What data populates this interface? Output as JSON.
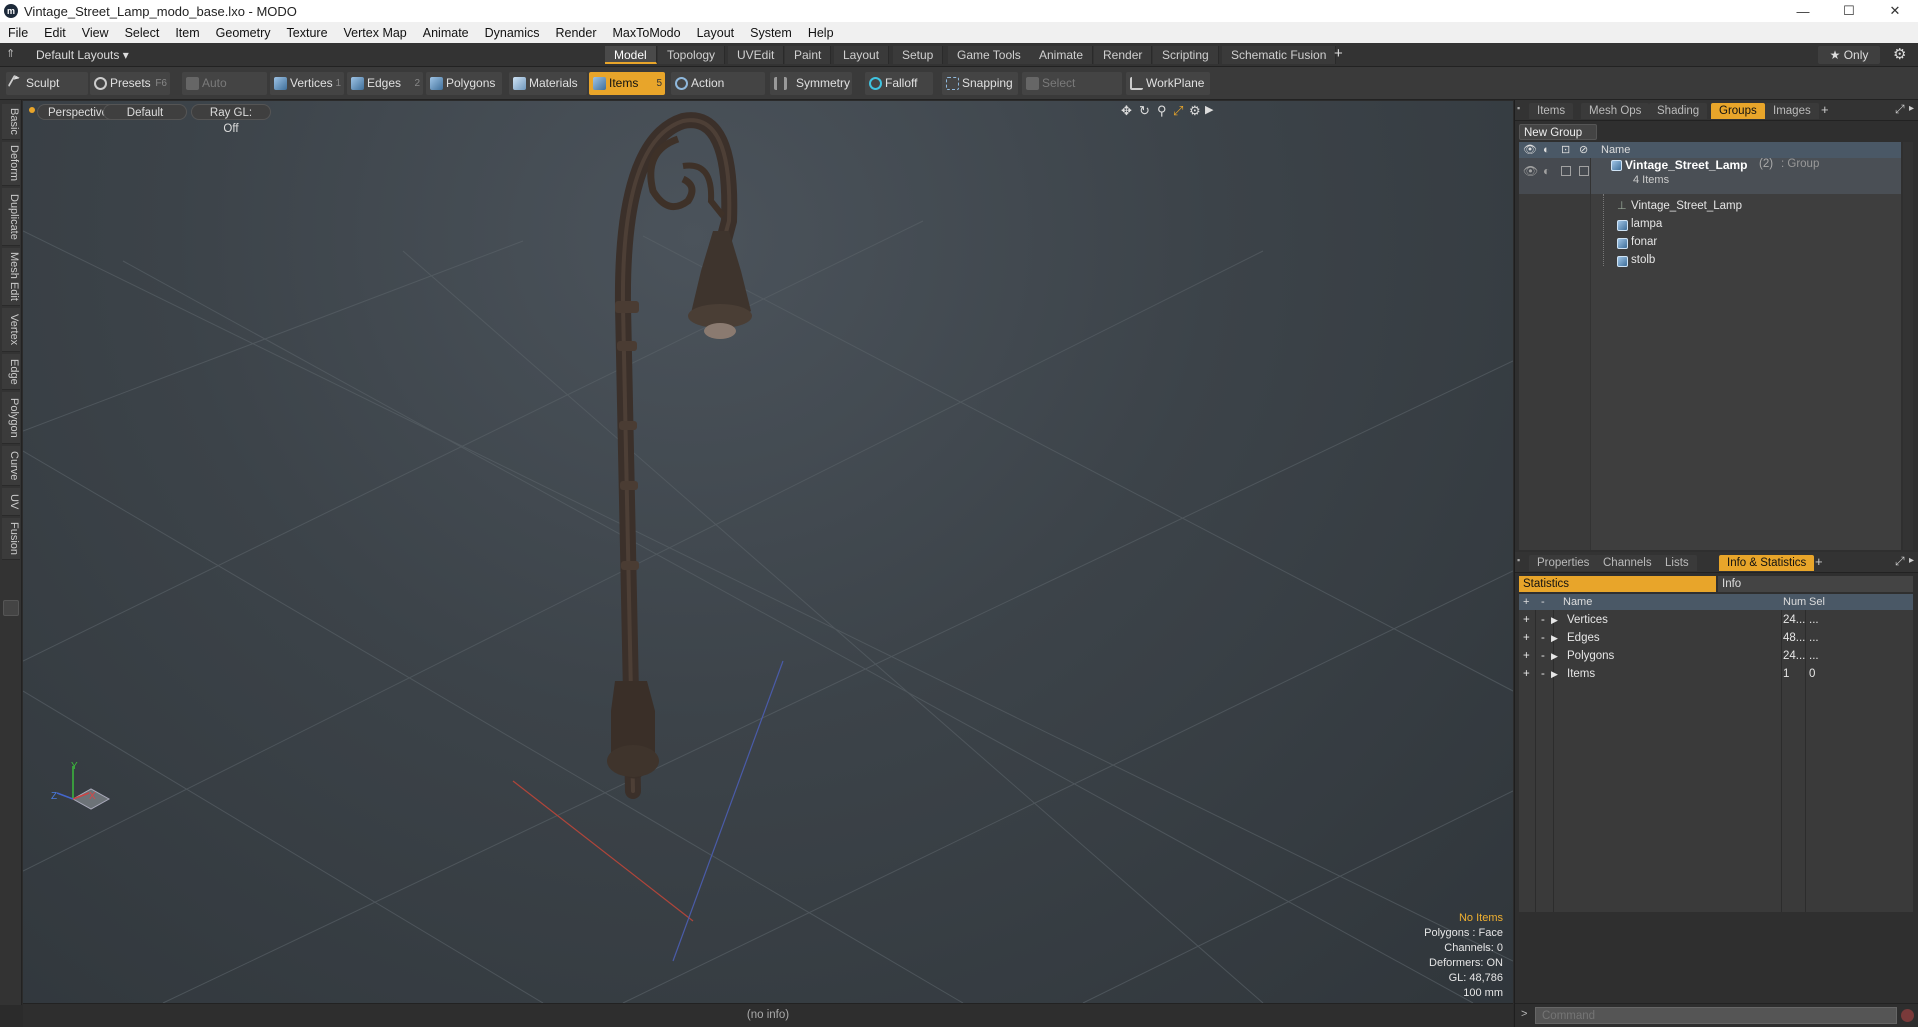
{
  "window": {
    "title": "Vintage_Street_Lamp_modo_base.lxo - MODO",
    "minimize": "—",
    "maximize": "☐",
    "close": "✕"
  },
  "menu": [
    "File",
    "Edit",
    "View",
    "Select",
    "Item",
    "Geometry",
    "Texture",
    "Vertex Map",
    "Animate",
    "Dynamics",
    "Render",
    "MaxToModo",
    "Layout",
    "System",
    "Help"
  ],
  "layouts": {
    "dropdown": "Default Layouts ▾",
    "tabs": [
      "Model",
      "Topology",
      "UVEdit",
      "Paint",
      "Layout",
      "Setup",
      "Game Tools",
      "Animate",
      "Render",
      "Scripting",
      "Schematic Fusion"
    ],
    "active": "Model",
    "add": "+",
    "only": "★  Only",
    "gear": "⚙"
  },
  "toolbar": {
    "sculpt": "Sculpt",
    "presets": "Presets",
    "presets_key": "F6",
    "auto_select": "Auto Select",
    "vertices": "Vertices",
    "vertices_key": "1",
    "edges": "Edges",
    "edges_key": "2",
    "polygons": "Polygons",
    "materials": "Materials",
    "items": "Items",
    "items_key": "5",
    "action_center": "Action Center",
    "symmetry": "Symmetry",
    "falloff": "Falloff",
    "snapping": "Snapping",
    "select_through": "Select Through",
    "workplane": "WorkPlane"
  },
  "left_tabs": [
    "Basic",
    "Deform",
    "Duplicate",
    "Mesh Edit",
    "Vertex",
    "Edge",
    "Polygon",
    "Curve",
    "UV",
    "Fusion"
  ],
  "viewport": {
    "view": "Perspective",
    "shading": "Default",
    "raygl": "Ray GL: Off",
    "stats": {
      "selection": "No Items",
      "polygons": "Polygons : Face",
      "channels": "Channels: 0",
      "deformers": "Deformers: ON",
      "gl": "GL: 48,786",
      "scale": "100 mm"
    },
    "axis_labels": {
      "x": "X",
      "y": "Y",
      "z": "Z"
    }
  },
  "status_bar": "(no info)",
  "groups_panel": {
    "tabs": [
      "Items",
      "Mesh Ops",
      "Shading",
      "Groups",
      "Images"
    ],
    "active": "Groups",
    "new_group": "New Group",
    "column_name": "Name",
    "group": {
      "name": "Vintage_Street_Lamp",
      "count": "(2)",
      "type": ": Group",
      "sub": "4 Items"
    },
    "children": [
      "Vintage_Street_Lamp",
      "lampa",
      "fonar",
      "stolb"
    ]
  },
  "stats_panel": {
    "tabs": [
      "Properties",
      "Channels",
      "Lists",
      "Info & Statistics"
    ],
    "active": "Info & Statistics",
    "sub_tabs": [
      "Statistics",
      "Info"
    ],
    "columns": {
      "name": "Name",
      "num": "Num",
      "sel": "Sel"
    },
    "rows": [
      {
        "name": "Vertices",
        "num": "24...",
        "sel": "..."
      },
      {
        "name": "Edges",
        "num": "48...",
        "sel": "..."
      },
      {
        "name": "Polygons",
        "num": "24...",
        "sel": "..."
      },
      {
        "name": "Items",
        "num": "1",
        "sel": "0"
      }
    ]
  },
  "command": {
    "placeholder": "Command",
    "prompt": ">"
  },
  "colors": {
    "accent": "#e8a52a",
    "viewport": "#3c4349",
    "panel": "#2f2f2f"
  }
}
